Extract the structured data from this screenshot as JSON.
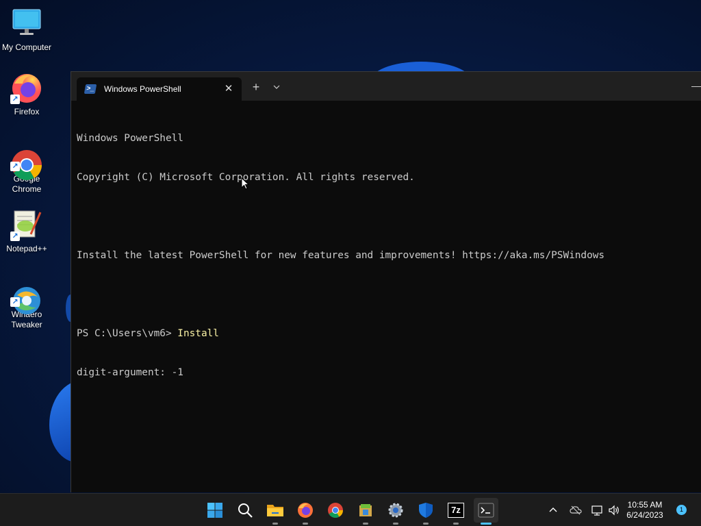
{
  "desktop": {
    "icons": [
      {
        "label": "My Computer"
      },
      {
        "label": "Firefox"
      },
      {
        "label": "Google\nChrome"
      },
      {
        "label": "Notepad++"
      },
      {
        "label": "Winaero\nTweaker"
      }
    ]
  },
  "terminal": {
    "tab_title": "Windows PowerShell",
    "new_tab_symbol": "+",
    "dropdown_symbol": "⌄",
    "close_symbol": "✕",
    "lines": [
      "Windows PowerShell",
      "Copyright (C) Microsoft Corporation. All rights reserved.",
      "",
      "Install the latest PowerShell for new features and improvements! https://aka.ms/PSWindows",
      ""
    ],
    "prompt": "PS C:\\Users\\vm6> ",
    "command": "Install",
    "output_line": "digit-argument: -1"
  },
  "taskbar": {
    "apps": [
      "start-icon",
      "search-icon",
      "file-explorer-icon",
      "firefox-icon",
      "chrome-icon",
      "app-icon",
      "settings-icon",
      "defender-icon",
      "7zip-icon",
      "terminal-icon"
    ],
    "sevenzip_label": "7z",
    "clock_time": "10:55 AM",
    "clock_date": "6/24/2023",
    "notification_count": "1"
  },
  "colors": {
    "console_bg": "#0c0c0c",
    "console_text": "#cccccc",
    "command_text": "#f9f1a5",
    "accent": "#4cc2ff"
  }
}
